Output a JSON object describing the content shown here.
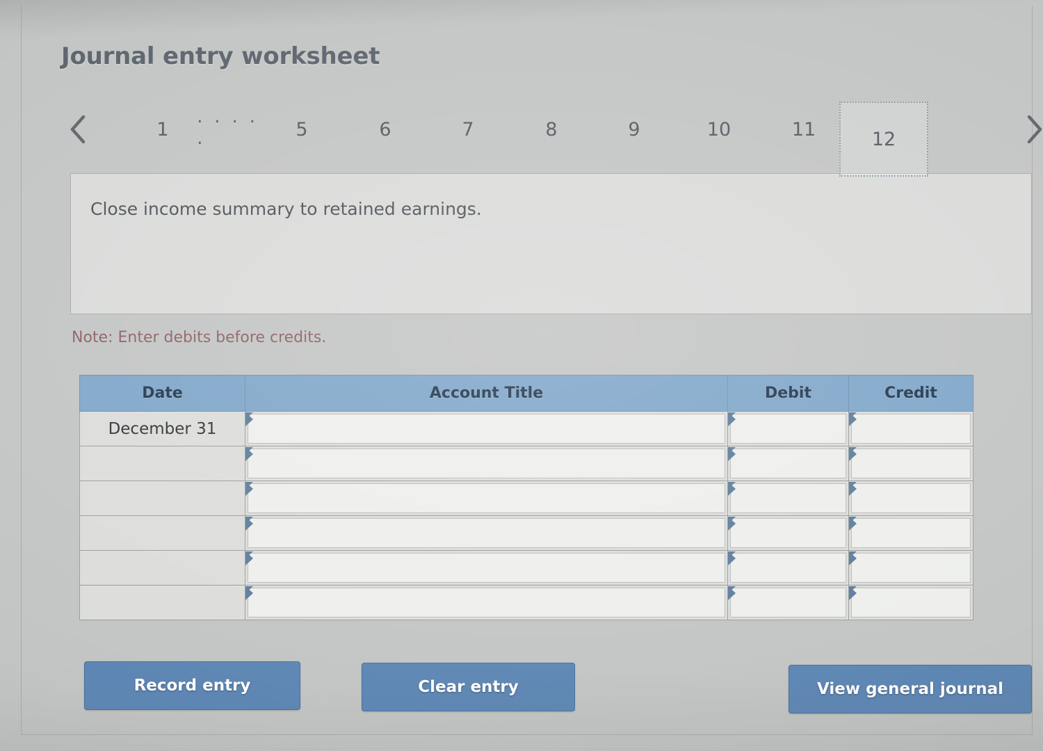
{
  "page_title": "Journal entry worksheet",
  "pagination": {
    "prev_icon": "chevron-left-icon",
    "next_icon": "chevron-right-icon",
    "ellipsis": ". . . . .",
    "items": [
      {
        "label": "1",
        "selected": false
      },
      {
        "label": "5",
        "selected": false
      },
      {
        "label": "6",
        "selected": false
      },
      {
        "label": "7",
        "selected": false
      },
      {
        "label": "8",
        "selected": false
      },
      {
        "label": "9",
        "selected": false
      },
      {
        "label": "10",
        "selected": false
      },
      {
        "label": "11",
        "selected": false
      },
      {
        "label": "12",
        "selected": true
      }
    ],
    "selected_label": "12"
  },
  "prompt": {
    "text": "Close income summary to retained earnings."
  },
  "note": {
    "text": "Note: Enter debits before credits."
  },
  "table": {
    "headers": {
      "date": "Date",
      "account_title": "Account Title",
      "debit": "Debit",
      "credit": "Credit"
    },
    "rows": [
      {
        "date": "December 31",
        "account_title": "",
        "debit": "",
        "credit": ""
      },
      {
        "date": "",
        "account_title": "",
        "debit": "",
        "credit": ""
      },
      {
        "date": "",
        "account_title": "",
        "debit": "",
        "credit": ""
      },
      {
        "date": "",
        "account_title": "",
        "debit": "",
        "credit": ""
      },
      {
        "date": "",
        "account_title": "",
        "debit": "",
        "credit": ""
      },
      {
        "date": "",
        "account_title": "",
        "debit": "",
        "credit": ""
      }
    ]
  },
  "buttons": {
    "record": "Record entry",
    "clear": "Clear entry",
    "view_journal": "View general journal"
  },
  "colors": {
    "page_background": "#c3c5c4",
    "header_blue": "#7fa6c9",
    "button_blue": "#5d86b4",
    "note_red": "#8d5f63",
    "title_gray": "#5c646d"
  }
}
